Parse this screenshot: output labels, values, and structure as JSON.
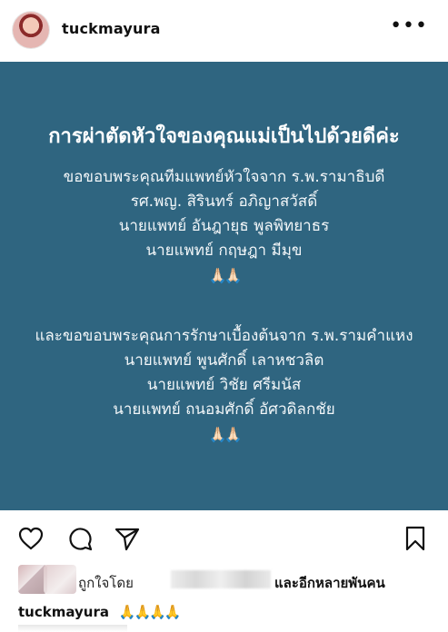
{
  "header": {
    "username": "tuckmayura",
    "more_label": "•••"
  },
  "post": {
    "title": "การผ่าตัดหัวใจของคุณแม่เป็นไปด้วยดีค่ะ",
    "para1": [
      "ขอขอบพระคุณทีมแพทย์หัวใจจาก ร.พ.รามาธิบดี",
      "รศ.พญ. สิรินทร์ อภิญาสวัสดิ์",
      "นายแพทย์ อันฎายุธ พูลพิทยาธร",
      "นายแพทย์ กฤษฎา มีมุข",
      "🙏🏻🙏🏻"
    ],
    "para2": [
      "และขอขอบพระคุณการรักษาเบื้องต้นจาก ร.พ.รามคำแหง",
      "นายแพทย์ พูนศักดิ์ เลาหชวลิต",
      "นายแพทย์ วิชัย ศรีมนัส",
      "นายแพทย์ ถนอมศักดิ์ อัศวดิลกชัย",
      "🙏🏻🙏🏻"
    ],
    "background_color": "#2f6580"
  },
  "actions": {
    "icons": [
      "heart-icon",
      "comment-icon",
      "share-icon",
      "bookmark-icon"
    ]
  },
  "likes": {
    "prefix": "ถูกใจโดย",
    "suffix": "และอีกหลายพันคน"
  },
  "caption": {
    "username": "tuckmayura",
    "text": "🙏🙏🙏🙏"
  }
}
